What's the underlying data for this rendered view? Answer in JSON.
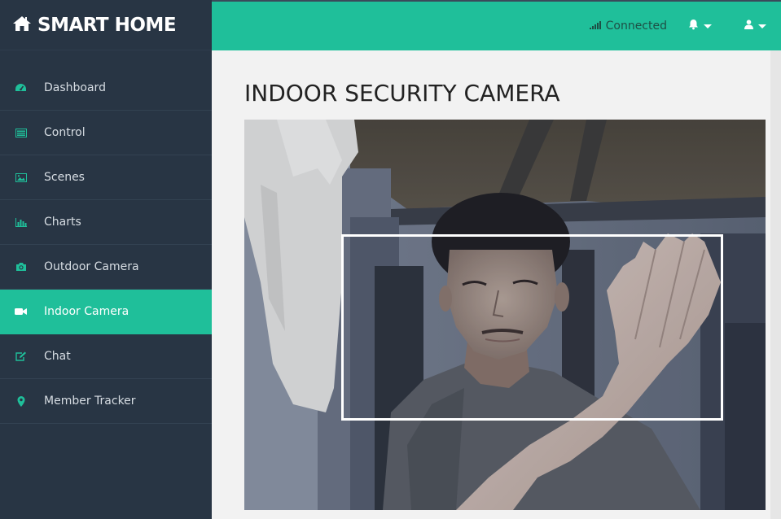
{
  "brand": {
    "title": "SMART HOME",
    "icon": "home-icon"
  },
  "sidebar": {
    "items": [
      {
        "label": "Dashboard",
        "icon": "dashboard-icon",
        "active": false
      },
      {
        "label": "Control",
        "icon": "list-icon",
        "active": false
      },
      {
        "label": "Scenes",
        "icon": "picture-icon",
        "active": false
      },
      {
        "label": "Charts",
        "icon": "bar-chart-icon",
        "active": false
      },
      {
        "label": "Outdoor Camera",
        "icon": "camera-icon",
        "active": false
      },
      {
        "label": "Indoor Camera",
        "icon": "video-camera-icon",
        "active": true
      },
      {
        "label": "Chat",
        "icon": "edit-icon",
        "active": false
      },
      {
        "label": "Member Tracker",
        "icon": "map-marker-icon",
        "active": false
      }
    ]
  },
  "topbar": {
    "status": "Connected",
    "status_icon": "signal-icon",
    "notifications_icon": "bell-icon",
    "user_icon": "user-icon"
  },
  "main": {
    "title": "INDOOR SECURITY CAMERA"
  },
  "colors": {
    "accent": "#1fbf9a",
    "sidebar_bg": "#283544",
    "main_bg": "#f2f2f2"
  }
}
